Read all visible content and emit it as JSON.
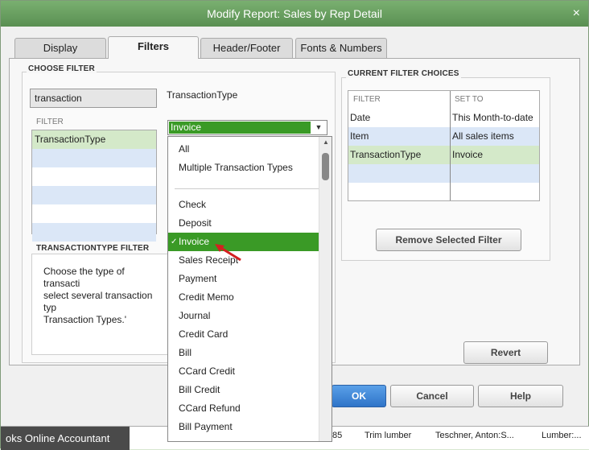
{
  "window": {
    "title": "Modify Report: Sales by Rep Detail",
    "close_glyph": "×"
  },
  "tabs": [
    {
      "label": "Display",
      "active": false
    },
    {
      "label": "Filters",
      "active": true
    },
    {
      "label": "Header/Footer",
      "active": false
    },
    {
      "label": "Fonts & Numbers",
      "active": false
    }
  ],
  "choose_filter": {
    "title": "CHOOSE FILTER",
    "search_value": "transaction",
    "filter_col_header": "FILTER",
    "filter_items": [
      "TransactionType",
      "",
      "",
      "",
      "",
      ""
    ],
    "type_label": "TransactionType",
    "combo_value": "Invoice"
  },
  "transactiontype_filter": {
    "title": "TRANSACTIONTYPE FILTER",
    "description": "Choose the type of transacti\nselect several transaction typ\nTransaction Types.'"
  },
  "dropdown": {
    "group1": [
      "All",
      "Multiple Transaction Types"
    ],
    "group2": [
      "Check",
      "Deposit",
      "Invoice",
      "Sales Receipt",
      "Payment",
      "Credit Memo",
      "Journal",
      "Credit Card",
      "Bill",
      "CCard Credit",
      "Bill Credit",
      "CCard Refund",
      "Bill Payment"
    ],
    "selected": "Invoice",
    "check_glyph": "✓"
  },
  "current_filter": {
    "title": "CURRENT FILTER CHOICES",
    "col_filter": "FILTER",
    "col_setto": "SET TO",
    "rows": [
      {
        "filter": "Date",
        "set_to": "This Month-to-date"
      },
      {
        "filter": "Item",
        "set_to": "All sales items"
      },
      {
        "filter": "TransactionType",
        "set_to": "Invoice"
      },
      {
        "filter": "",
        "set_to": ""
      },
      {
        "filter": "",
        "set_to": ""
      }
    ],
    "remove_label": "Remove Selected Filter"
  },
  "buttons": {
    "revert": "Revert",
    "ok": "OK",
    "cancel": "Cancel",
    "help": "Help"
  },
  "taskbar": {
    "app_label": "oks Online Accountant",
    "cells": [
      "85",
      "Trim lumber",
      "Teschner, Anton:S...",
      "Lumber:..."
    ]
  },
  "colors": {
    "accent_green": "#3a9a26",
    "titlebar": "#6aa560",
    "ok_blue": "#2f74c8"
  }
}
